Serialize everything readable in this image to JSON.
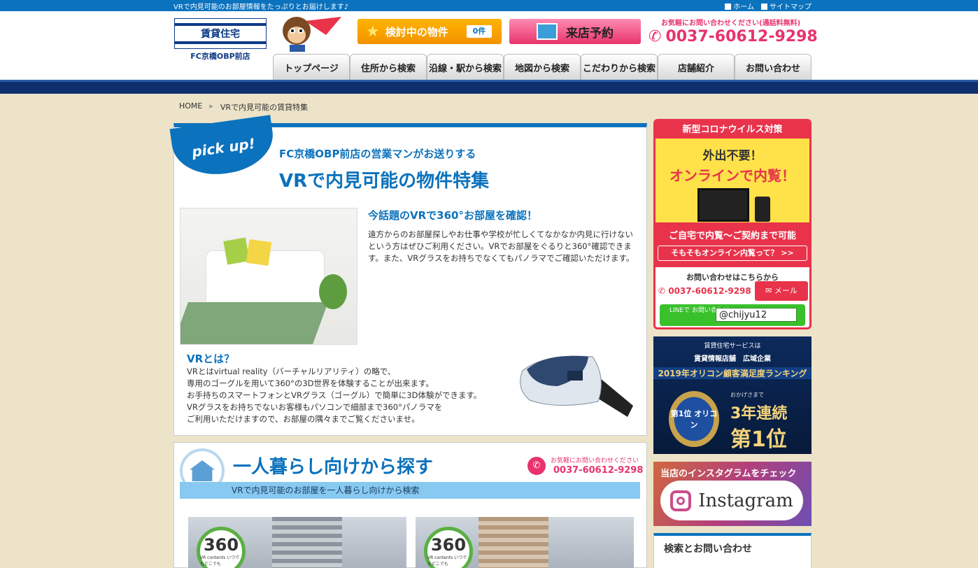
{
  "topbar": {
    "tagline": "VRで内見可能のお部屋情報をたっぷりとお届けします♪",
    "links": [
      "ホーム",
      "サイトマップ"
    ]
  },
  "header": {
    "logo_text": "賃貸住宅",
    "shop_name": "FC京橋OBP前店",
    "kento_label": "検討中の物件",
    "kento_count": "0件",
    "raiten_label": "来店予約",
    "tel_note": "お気軽にお問い合わせください(通話料無料)",
    "tel": "0037-60612-9298"
  },
  "nav": [
    "トップページ",
    "住所から検索",
    "沿線・駅から検索",
    "地図から検索",
    "こだわりから検索",
    "店舗紹介",
    "お問い合わせ"
  ],
  "breadcrumb": [
    "HOME",
    "VRで内見可能の賃貸特集"
  ],
  "feature": {
    "pickup": "pick up!",
    "subtitle": "FC京橋OBP前店の営業マンがお送りする",
    "title": "VRで内見可能の物件特集",
    "h3": "今話題のVRで360°お部屋を確認！",
    "para": "遠方からのお部屋探しやお仕事や学校が忙しくてなかなか内見に行けないという方はぜひご利用ください。VRでお部屋をぐるりと360°確認できます。また、VRグラスをお持ちでなくてもパノラマでご確認いただけます。",
    "vr_heading": "VRとは？",
    "vr_lines": [
      "VRとはvirtual reality（バーチャルリアリティ）の略で、",
      "専用のゴーグルを用いて360°の3D世界を体験することが出来ます。",
      "お手持ちのスマートフォンとVRグラス（ゴーグル）で簡単に3D体験ができます。",
      "VRグラスをお持ちでないお客様もパソコンで細部まで360°パノラマを",
      "ご利用いただけますので、お部屋の隅々までご覧くださいませ。"
    ]
  },
  "single": {
    "title": "一人暮らし向けから探す",
    "tel_note": "お気軽にお問い合わせください",
    "tel": "0037-60612-9298",
    "bar": "VRで内見可能のお部屋を一人暮らし向けから検索",
    "badge_num": "360",
    "badge_txt": "VR contents いつでもどこでも"
  },
  "sidebar": {
    "covid_head": "新型コロナウイルス対策",
    "covid_a": "外出不要！",
    "covid_b": "オンラインで内覧！",
    "covid_band": "ご自宅で内覧～ご契約まで可能",
    "covid_btn": "そもそもオンライン内覧って？ >>",
    "ask": "お問い合わせはこちらから",
    "tel": "0037-60612-9298",
    "mail": "メール",
    "line_label": "LINEで お問い合わせ",
    "line_id": "@chijyu12",
    "oricon_t1": "賃貸住宅サービスは",
    "oricon_t2": "賃貸情報店舗　広域企業",
    "oricon_t3": "2019年オリコン顧客満足度ランキング",
    "oricon_medal": "第1位 オリコン",
    "oricon_r1": "おかげさまで",
    "oricon_r2": "3年連続",
    "oricon_r3": "第1位",
    "insta_head": "当店のインスタグラムをチェック",
    "insta_label": "Instagram",
    "search_head": "検索とお問い合わせ"
  }
}
